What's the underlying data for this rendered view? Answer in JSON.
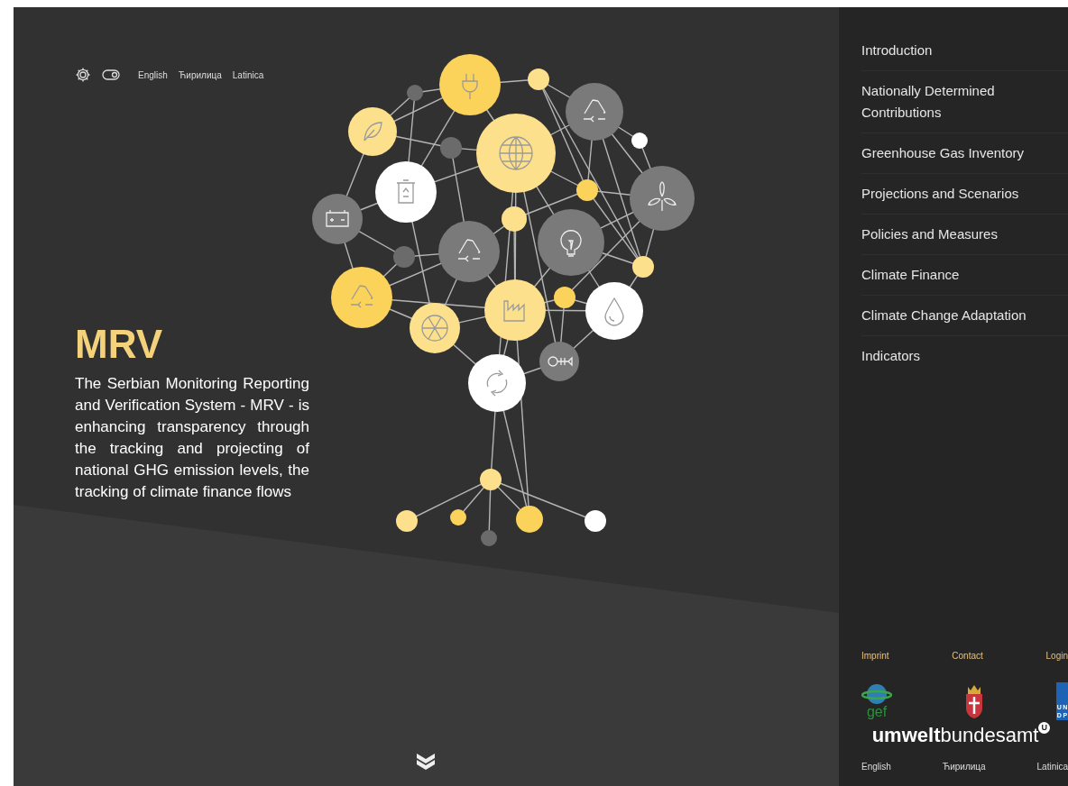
{
  "header": {
    "toggle": {
      "on": true
    },
    "languages": [
      "English",
      "Ћирилица",
      "Latinica"
    ]
  },
  "hero": {
    "title": "MRV",
    "text": "The Serbian Monitoring Reporting and Verification System - MRV - is enhancing transparency through the tracking and projecting of national GHG emission levels, the tracking of climate finance flows"
  },
  "sidebar": {
    "items": [
      "Introduction",
      "Nationally Determined Contributions",
      "Greenhouse Gas Inventory",
      "Projections and Scenarios",
      "Policies and Measures",
      "Climate Finance",
      "Climate Change Adaptation",
      "Indicators"
    ],
    "footer_links": [
      "Imprint",
      "Contact",
      "Login"
    ],
    "logos": {
      "gef": "gef",
      "undp": [
        "U",
        "N",
        "D",
        "P"
      ],
      "umweltbundesamt": "**umwelt**bundesamt",
      "umweltbundesamt_mark": "U"
    },
    "languages": [
      "English",
      "Ћирилица",
      "Latinica"
    ]
  }
}
